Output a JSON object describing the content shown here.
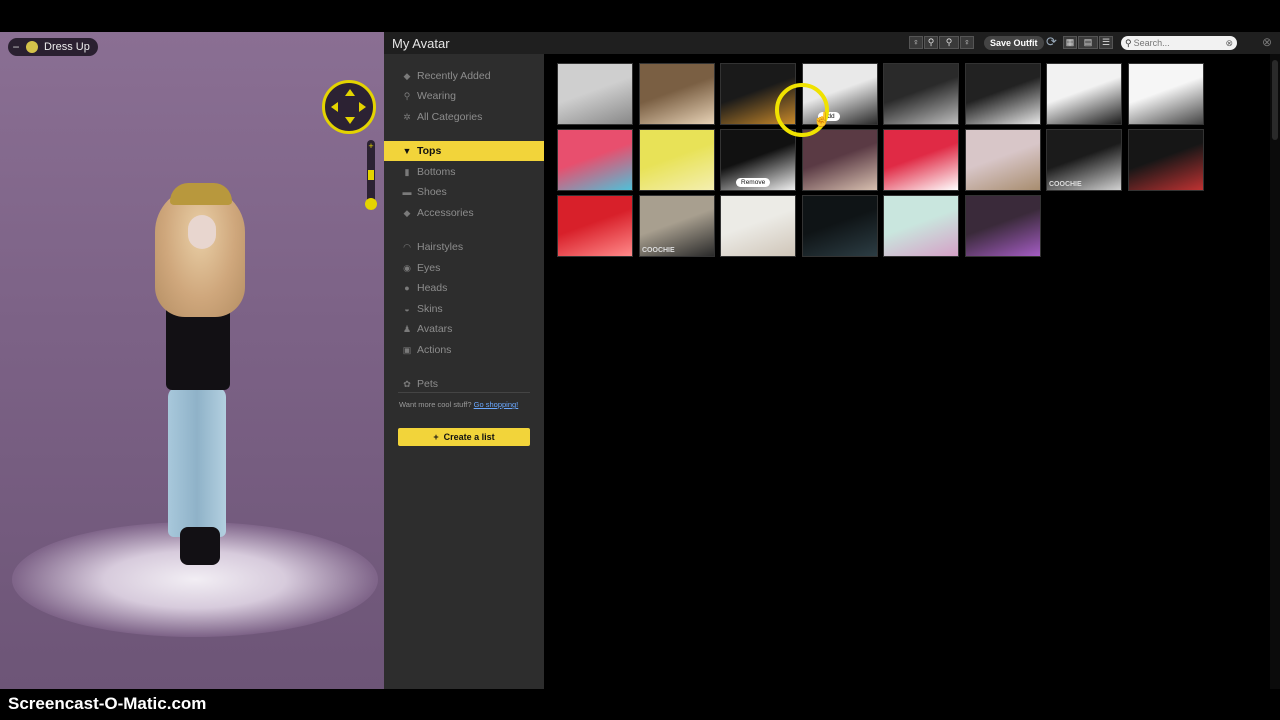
{
  "stage": {
    "dress_up_label": "Dress Up",
    "minus_glyph": "−"
  },
  "window": {
    "title": "My Avatar",
    "save_outfit_label": "Save Outfit",
    "search_placeholder": "Search...",
    "close_glyph": "⊗",
    "clear_glyph": "⊗"
  },
  "sidebar": {
    "items": [
      {
        "label": "Recently Added",
        "icon": "tag-icon"
      },
      {
        "label": "Wearing",
        "icon": "hanger-icon"
      },
      {
        "label": "All Categories",
        "icon": "gear-icon"
      },
      {
        "label": "Tops",
        "icon": "shirt-icon"
      },
      {
        "label": "Bottoms",
        "icon": "pants-icon"
      },
      {
        "label": "Shoes",
        "icon": "shoe-icon"
      },
      {
        "label": "Accessories",
        "icon": "diamond-icon"
      },
      {
        "label": "Hairstyles",
        "icon": "hair-icon"
      },
      {
        "label": "Eyes",
        "icon": "eye-icon"
      },
      {
        "label": "Heads",
        "icon": "head-icon"
      },
      {
        "label": "Skins",
        "icon": "lips-icon"
      },
      {
        "label": "Avatars",
        "icon": "person-icon"
      },
      {
        "label": "Actions",
        "icon": "film-icon"
      },
      {
        "label": "Pets",
        "icon": "paw-icon"
      }
    ],
    "active": "Tops",
    "promo_text": "Want more cool stuff?",
    "promo_link": "Go shopping!",
    "create_list_label": "Create a list",
    "create_list_glyph": "+"
  },
  "grid": {
    "tiles": [
      {
        "color": "#cfcfcf",
        "accent": "#888888"
      },
      {
        "color": "#7a5f43",
        "accent": "#e7d2b6"
      },
      {
        "color": "#1a1a1a",
        "accent": "#c8892a"
      },
      {
        "color": "#e9e9e9",
        "accent": "#2a2a2a",
        "badge": "Add"
      },
      {
        "color": "#2a2a2a",
        "accent": "#bdbdbd"
      },
      {
        "color": "#222222",
        "accent": "#e6e6e6"
      },
      {
        "color": "#f2f2f2",
        "accent": "#1c1c1c"
      },
      {
        "color": "#f6f6f6",
        "accent": "#444444"
      },
      {
        "color": "#e84f6e",
        "accent": "#4fc1d9"
      },
      {
        "color": "#e8e257",
        "accent": "#f4efb0"
      },
      {
        "color": "#111111",
        "accent": "#f0f0f0",
        "badge": "Remove"
      },
      {
        "color": "#5a3a44",
        "accent": "#d8c0b0"
      },
      {
        "color": "#e02a45",
        "accent": "#ffffff"
      },
      {
        "color": "#d8c6c8",
        "accent": "#a88d6f"
      },
      {
        "color": "#1b1b1b",
        "accent": "#d2d2d2",
        "tag": "COOCHIE"
      },
      {
        "color": "#161616",
        "accent": "#bf3232"
      },
      {
        "color": "#d8202a",
        "accent": "#ff8a8a"
      },
      {
        "color": "#a89f8f",
        "accent": "#2a2a2a",
        "tag": "COOCHIE"
      },
      {
        "color": "#ecebe6",
        "accent": "#cfc5b8"
      },
      {
        "color": "#0f1416",
        "accent": "#2c3d44"
      },
      {
        "color": "#c9e6de",
        "accent": "#d5a0c6"
      },
      {
        "color": "#3a2a3a",
        "accent": "#a45cc3"
      }
    ]
  },
  "watermark": "Screencast-O-Matic.com"
}
